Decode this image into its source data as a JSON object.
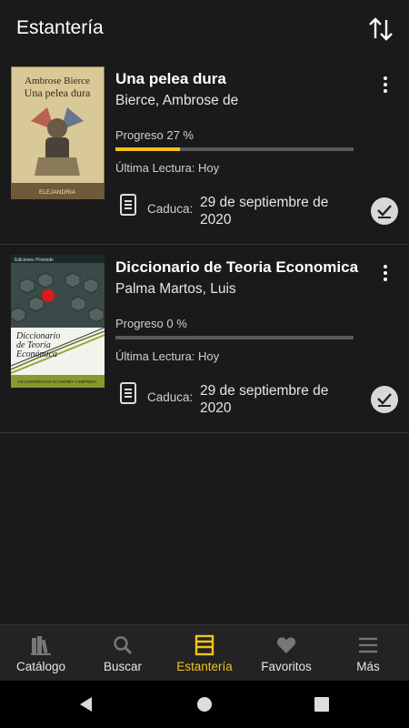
{
  "colors": {
    "accent": "#f3c21c",
    "background": "#1a1a1a",
    "track": "#5a5a5a"
  },
  "header": {
    "title": "Estantería",
    "sort_icon": "sort-arrows-icon"
  },
  "books": [
    {
      "title": "Una pelea dura",
      "author": "Bierce, Ambrose de",
      "cover_author": "Ambrose Bierce",
      "cover_title": "Una pelea dura",
      "cover_publisher": "ELEJANDRIA",
      "progress_label": "Progreso 27 %",
      "progress": 27,
      "last_read": "Última Lectura: Hoy",
      "expires_label": "Caduca:",
      "expires_date": "29 de septiembre de 2020"
    },
    {
      "title": "Diccionario de Teoria Economica",
      "author": "Palma Martos, Luis",
      "cover_top": "Ediciones Pirámide",
      "cover_title_1": "Diccionario",
      "cover_title_2": "de Teoría",
      "cover_title_3": "Económica",
      "cover_bottom": "DICCIONARIOS DE ECONOMÍA Y EMPRESA",
      "progress_label": "Progreso 0 %",
      "progress": 0,
      "last_read": "Última Lectura: Hoy",
      "expires_label": "Caduca:",
      "expires_date": "29 de septiembre de 2020"
    }
  ],
  "nav": [
    {
      "label": "Catálogo",
      "icon": "books-icon",
      "active": false
    },
    {
      "label": "Buscar",
      "icon": "search-icon",
      "active": false
    },
    {
      "label": "Estantería",
      "icon": "shelf-icon",
      "active": true
    },
    {
      "label": "Favoritos",
      "icon": "heart-icon",
      "active": false
    },
    {
      "label": "Más",
      "icon": "menu-icon",
      "active": false
    }
  ]
}
